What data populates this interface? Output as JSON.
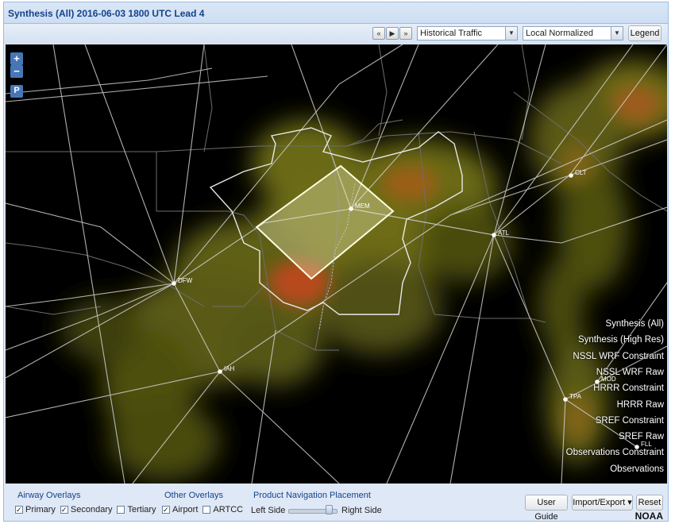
{
  "header": {
    "title": "Synthesis (All) 2016-06-03 1800 UTC Lead 4"
  },
  "toolbar": {
    "nav": {
      "first": "«",
      "play": "▶",
      "last": "»"
    },
    "overlay_select": "Historical Traffic",
    "normalize_select": "Local Normalized",
    "legend_label": "Legend"
  },
  "map": {
    "zoom_in": "+",
    "zoom_out": "−",
    "p_button": "P",
    "airports": [
      "MEM",
      "ATL",
      "DFW",
      "IAH",
      "CLT",
      "MOD",
      "TPA",
      "FLL"
    ],
    "products": [
      "Synthesis (All)",
      "Synthesis (High Res)",
      "NSSL WRF Constraint",
      "NSSL WRF Raw",
      "HRRR Constraint",
      "HRRR Raw",
      "SREF Constraint",
      "SREF Raw",
      "Observations Constraint",
      "Observations"
    ]
  },
  "bottom": {
    "airway_title": "Airway Overlays",
    "airway": [
      {
        "label": "Primary",
        "checked": true
      },
      {
        "label": "Secondary",
        "checked": true
      },
      {
        "label": "Tertiary",
        "checked": false
      }
    ],
    "other_title": "Other Overlays",
    "other": [
      {
        "label": "Airport",
        "checked": true
      },
      {
        "label": "ARTCC",
        "checked": false
      }
    ],
    "placement_title": "Product Navigation Placement",
    "left_label": "Left Side",
    "right_label": "Right Side",
    "user_guide": "User Guide",
    "import_export": "Import/Export ▾",
    "reset": "Reset",
    "brand": "NOAA"
  }
}
